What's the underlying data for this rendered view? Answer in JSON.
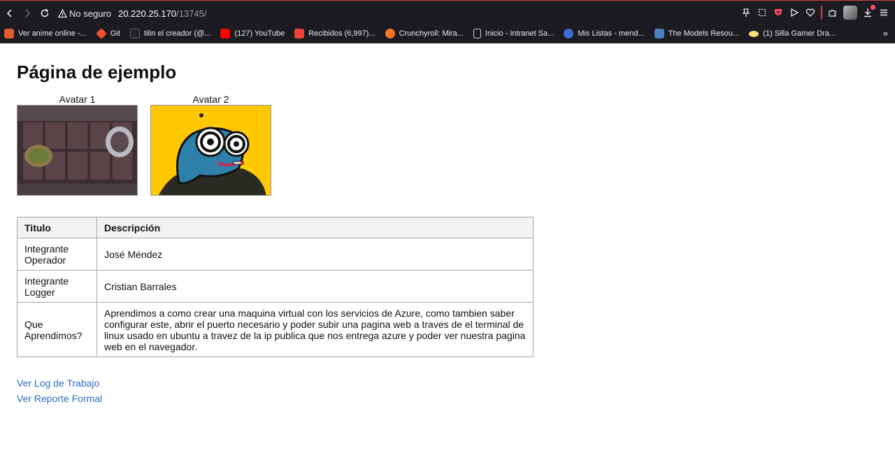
{
  "browser": {
    "url_warning": "No seguro",
    "url_host": "20.220.25.170",
    "url_path": "/13745/",
    "bookmarks": [
      {
        "label": "Ver anime online -...",
        "color": "#e25c2a"
      },
      {
        "label": "Git",
        "color": "#f05033"
      },
      {
        "label": "tilin el creador (@...",
        "color": "#222222"
      },
      {
        "label": "(127) YouTube",
        "color": "#ff0000"
      },
      {
        "label": "Recibidos (6,997)...",
        "color": "#ea4335"
      },
      {
        "label": "Crunchyroll: Mira...",
        "color": "#f47521"
      },
      {
        "label": "Inicio - Intranet Sa...",
        "color": "#cccccc"
      },
      {
        "label": "Mis Listas - mend...",
        "color": "#3b6fd8"
      },
      {
        "label": "The Models Resou...",
        "color": "#4a7fc0"
      },
      {
        "label": "(1) Silla Gamer Dra...",
        "color": "#f3e07a"
      }
    ]
  },
  "page": {
    "title": "Página de ejemplo",
    "avatars": [
      {
        "caption": "Avatar 1"
      },
      {
        "caption": "Avatar 2"
      }
    ],
    "table": {
      "headers": [
        "Titulo",
        "Descripción"
      ],
      "rows": [
        {
          "title": "Integrante Operador",
          "desc": "José Méndez"
        },
        {
          "title": "Integrante Logger",
          "desc": "Cristian Barrales"
        },
        {
          "title": "Que Aprendimos?",
          "desc": "Aprendimos a como crear una maquina virtual con los servicios de Azure, como tambien saber configurar este, abrir el puerto necesario y poder subir una pagina web a traves de el terminal de linux usado en ubuntu a travez de la ip publica que nos entrega azure y poder ver nuestra pagina web en el navegador."
        }
      ]
    },
    "links": [
      "Ver Log de Trabajo",
      "Ver Reporte Formal"
    ]
  }
}
